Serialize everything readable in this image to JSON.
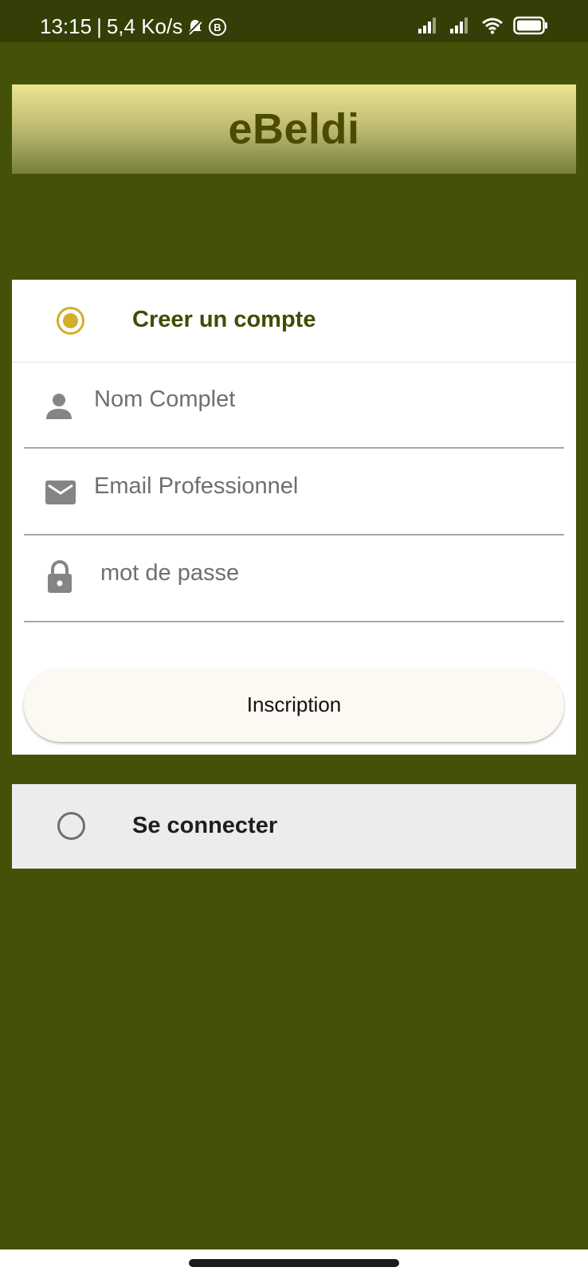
{
  "status_bar": {
    "time": "13:15",
    "separator": "|",
    "network_speed": "5,4 Ko/s",
    "icons": [
      "mute-bell-icon",
      "b-badge-icon",
      "signal-icon",
      "signal-icon",
      "wifi-icon",
      "battery-icon"
    ]
  },
  "header": {
    "title": "eBeldi"
  },
  "signup": {
    "label": "Creer un compte",
    "selected": true,
    "fields": {
      "name_placeholder": "Nom Complet",
      "email_placeholder": "Email Professionnel",
      "password_placeholder": "mot de passe"
    },
    "button_label": "Inscription"
  },
  "login": {
    "label": "Se connecter",
    "selected": false
  },
  "colors": {
    "background": "#445209",
    "status_bar": "#333F07",
    "accent": "#D1AF2A",
    "title": "#4B4C00"
  }
}
